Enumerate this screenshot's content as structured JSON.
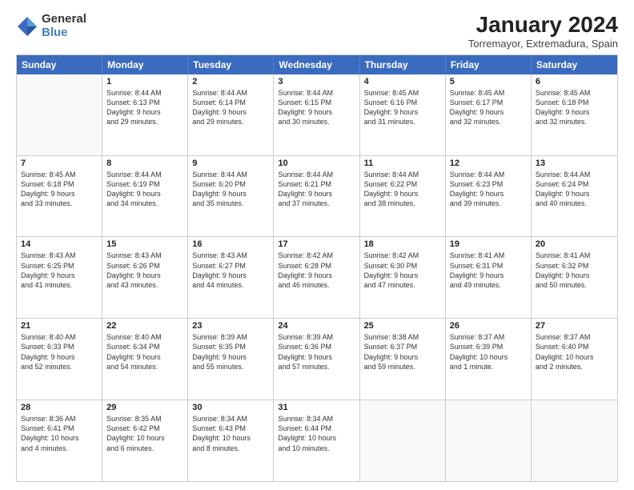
{
  "logo": {
    "general": "General",
    "blue": "Blue"
  },
  "title": "January 2024",
  "subtitle": "Torremayor, Extremadura, Spain",
  "header_days": [
    "Sunday",
    "Monday",
    "Tuesday",
    "Wednesday",
    "Thursday",
    "Friday",
    "Saturday"
  ],
  "rows": [
    [
      {
        "day": "",
        "lines": []
      },
      {
        "day": "1",
        "lines": [
          "Sunrise: 8:44 AM",
          "Sunset: 6:13 PM",
          "Daylight: 9 hours",
          "and 29 minutes."
        ]
      },
      {
        "day": "2",
        "lines": [
          "Sunrise: 8:44 AM",
          "Sunset: 6:14 PM",
          "Daylight: 9 hours",
          "and 29 minutes."
        ]
      },
      {
        "day": "3",
        "lines": [
          "Sunrise: 8:44 AM",
          "Sunset: 6:15 PM",
          "Daylight: 9 hours",
          "and 30 minutes."
        ]
      },
      {
        "day": "4",
        "lines": [
          "Sunrise: 8:45 AM",
          "Sunset: 6:16 PM",
          "Daylight: 9 hours",
          "and 31 minutes."
        ]
      },
      {
        "day": "5",
        "lines": [
          "Sunrise: 8:45 AM",
          "Sunset: 6:17 PM",
          "Daylight: 9 hours",
          "and 32 minutes."
        ]
      },
      {
        "day": "6",
        "lines": [
          "Sunrise: 8:45 AM",
          "Sunset: 6:18 PM",
          "Daylight: 9 hours",
          "and 32 minutes."
        ]
      }
    ],
    [
      {
        "day": "7",
        "lines": [
          "Sunrise: 8:45 AM",
          "Sunset: 6:18 PM",
          "Daylight: 9 hours",
          "and 33 minutes."
        ]
      },
      {
        "day": "8",
        "lines": [
          "Sunrise: 8:44 AM",
          "Sunset: 6:19 PM",
          "Daylight: 9 hours",
          "and 34 minutes."
        ]
      },
      {
        "day": "9",
        "lines": [
          "Sunrise: 8:44 AM",
          "Sunset: 6:20 PM",
          "Daylight: 9 hours",
          "and 35 minutes."
        ]
      },
      {
        "day": "10",
        "lines": [
          "Sunrise: 8:44 AM",
          "Sunset: 6:21 PM",
          "Daylight: 9 hours",
          "and 37 minutes."
        ]
      },
      {
        "day": "11",
        "lines": [
          "Sunrise: 8:44 AM",
          "Sunset: 6:22 PM",
          "Daylight: 9 hours",
          "and 38 minutes."
        ]
      },
      {
        "day": "12",
        "lines": [
          "Sunrise: 8:44 AM",
          "Sunset: 6:23 PM",
          "Daylight: 9 hours",
          "and 39 minutes."
        ]
      },
      {
        "day": "13",
        "lines": [
          "Sunrise: 8:44 AM",
          "Sunset: 6:24 PM",
          "Daylight: 9 hours",
          "and 40 minutes."
        ]
      }
    ],
    [
      {
        "day": "14",
        "lines": [
          "Sunrise: 8:43 AM",
          "Sunset: 6:25 PM",
          "Daylight: 9 hours",
          "and 41 minutes."
        ]
      },
      {
        "day": "15",
        "lines": [
          "Sunrise: 8:43 AM",
          "Sunset: 6:26 PM",
          "Daylight: 9 hours",
          "and 43 minutes."
        ]
      },
      {
        "day": "16",
        "lines": [
          "Sunrise: 8:43 AM",
          "Sunset: 6:27 PM",
          "Daylight: 9 hours",
          "and 44 minutes."
        ]
      },
      {
        "day": "17",
        "lines": [
          "Sunrise: 8:42 AM",
          "Sunset: 6:28 PM",
          "Daylight: 9 hours",
          "and 46 minutes."
        ]
      },
      {
        "day": "18",
        "lines": [
          "Sunrise: 8:42 AM",
          "Sunset: 6:30 PM",
          "Daylight: 9 hours",
          "and 47 minutes."
        ]
      },
      {
        "day": "19",
        "lines": [
          "Sunrise: 8:41 AM",
          "Sunset: 6:31 PM",
          "Daylight: 9 hours",
          "and 49 minutes."
        ]
      },
      {
        "day": "20",
        "lines": [
          "Sunrise: 8:41 AM",
          "Sunset: 6:32 PM",
          "Daylight: 9 hours",
          "and 50 minutes."
        ]
      }
    ],
    [
      {
        "day": "21",
        "lines": [
          "Sunrise: 8:40 AM",
          "Sunset: 6:33 PM",
          "Daylight: 9 hours",
          "and 52 minutes."
        ]
      },
      {
        "day": "22",
        "lines": [
          "Sunrise: 8:40 AM",
          "Sunset: 6:34 PM",
          "Daylight: 9 hours",
          "and 54 minutes."
        ]
      },
      {
        "day": "23",
        "lines": [
          "Sunrise: 8:39 AM",
          "Sunset: 6:35 PM",
          "Daylight: 9 hours",
          "and 55 minutes."
        ]
      },
      {
        "day": "24",
        "lines": [
          "Sunrise: 8:39 AM",
          "Sunset: 6:36 PM",
          "Daylight: 9 hours",
          "and 57 minutes."
        ]
      },
      {
        "day": "25",
        "lines": [
          "Sunrise: 8:38 AM",
          "Sunset: 6:37 PM",
          "Daylight: 9 hours",
          "and 59 minutes."
        ]
      },
      {
        "day": "26",
        "lines": [
          "Sunrise: 8:37 AM",
          "Sunset: 6:39 PM",
          "Daylight: 10 hours",
          "and 1 minute."
        ]
      },
      {
        "day": "27",
        "lines": [
          "Sunrise: 8:37 AM",
          "Sunset: 6:40 PM",
          "Daylight: 10 hours",
          "and 2 minutes."
        ]
      }
    ],
    [
      {
        "day": "28",
        "lines": [
          "Sunrise: 8:36 AM",
          "Sunset: 6:41 PM",
          "Daylight: 10 hours",
          "and 4 minutes."
        ]
      },
      {
        "day": "29",
        "lines": [
          "Sunrise: 8:35 AM",
          "Sunset: 6:42 PM",
          "Daylight: 10 hours",
          "and 6 minutes."
        ]
      },
      {
        "day": "30",
        "lines": [
          "Sunrise: 8:34 AM",
          "Sunset: 6:43 PM",
          "Daylight: 10 hours",
          "and 8 minutes."
        ]
      },
      {
        "day": "31",
        "lines": [
          "Sunrise: 8:34 AM",
          "Sunset: 6:44 PM",
          "Daylight: 10 hours",
          "and 10 minutes."
        ]
      },
      {
        "day": "",
        "lines": []
      },
      {
        "day": "",
        "lines": []
      },
      {
        "day": "",
        "lines": []
      }
    ]
  ]
}
